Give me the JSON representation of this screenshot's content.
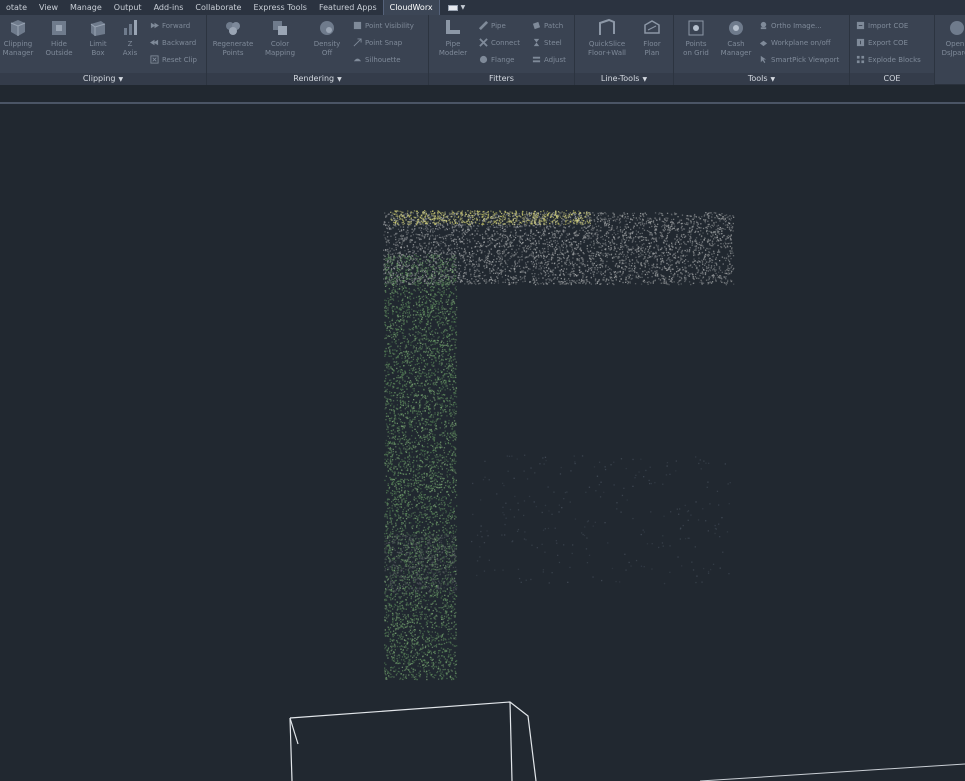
{
  "menu_tabs": [
    {
      "label": "otate"
    },
    {
      "label": "View"
    },
    {
      "label": "Manage"
    },
    {
      "label": "Output"
    },
    {
      "label": "Add-ins"
    },
    {
      "label": "Collaborate"
    },
    {
      "label": "Express Tools"
    },
    {
      "label": "Featured Apps"
    },
    {
      "label": "CloudWorx",
      "active": true
    }
  ],
  "ribbon": {
    "clipping": {
      "title": "Clipping",
      "clipping_manager": {
        "line1": "Clipping",
        "line2": "Manager"
      },
      "hide_outside": {
        "line1": "Hide",
        "line2": "Outside"
      },
      "limit_box": {
        "line1": "Limit",
        "line2": "Box"
      },
      "z_axis": {
        "line1": "Z",
        "line2": "Axis"
      },
      "forward": "Forward",
      "backward": "Backward",
      "reset_clip": "Reset Clip"
    },
    "rendering": {
      "title": "Rendering",
      "regenerate_points": {
        "line1": "Regenerate",
        "line2": "Points"
      },
      "color_mapping": {
        "line1": "Color",
        "line2": "Mapping"
      },
      "density_off": {
        "line1": "Density",
        "line2": "Off"
      },
      "point_visibility": "Point Visibility",
      "point_snap": "Point Snap",
      "silhouette": "Silhouette"
    },
    "fitters": {
      "title": "Fitters",
      "pipe_modeler": {
        "line1": "Pipe",
        "line2": "Modeler"
      },
      "pipe": "Pipe",
      "connect": "Connect",
      "flange": "Flange",
      "patch": "Patch",
      "steel": "Steel",
      "adjust": "Adjust"
    },
    "line_tools": {
      "title": "Line-Tools",
      "quickslice": {
        "line1": "QuickSlice",
        "line2": "Floor+Wall"
      },
      "floor_plan": {
        "line1": "Floor",
        "line2": "Plan"
      }
    },
    "tools": {
      "title": "Tools",
      "points_on_grid": {
        "line1": "Points",
        "line2": "on Grid"
      },
      "cash_manager": {
        "line1": "Cash",
        "line2": "Manager"
      },
      "ortho_image": "Ortho Image...",
      "workplane": "Workplane on/off",
      "smartpick": "SmartPick Viewport"
    },
    "coe": {
      "title": "COE",
      "import_coe": "Import COE",
      "export_coe": "Export COE",
      "explode_blocks": "Explode Blocks",
      "open_jetstream": {
        "line1": "Open",
        "line2": "DsJpare"
      }
    }
  },
  "colors": {
    "background": "#212830",
    "ribbon": "#3a4352",
    "tabbar": "#2b3340",
    "point_cloud_top": "#8d9092",
    "point_cloud_highlight": "#c8c66a",
    "point_cloud_green": "#5e8a5c",
    "wireframe": "#e2e6ea"
  }
}
